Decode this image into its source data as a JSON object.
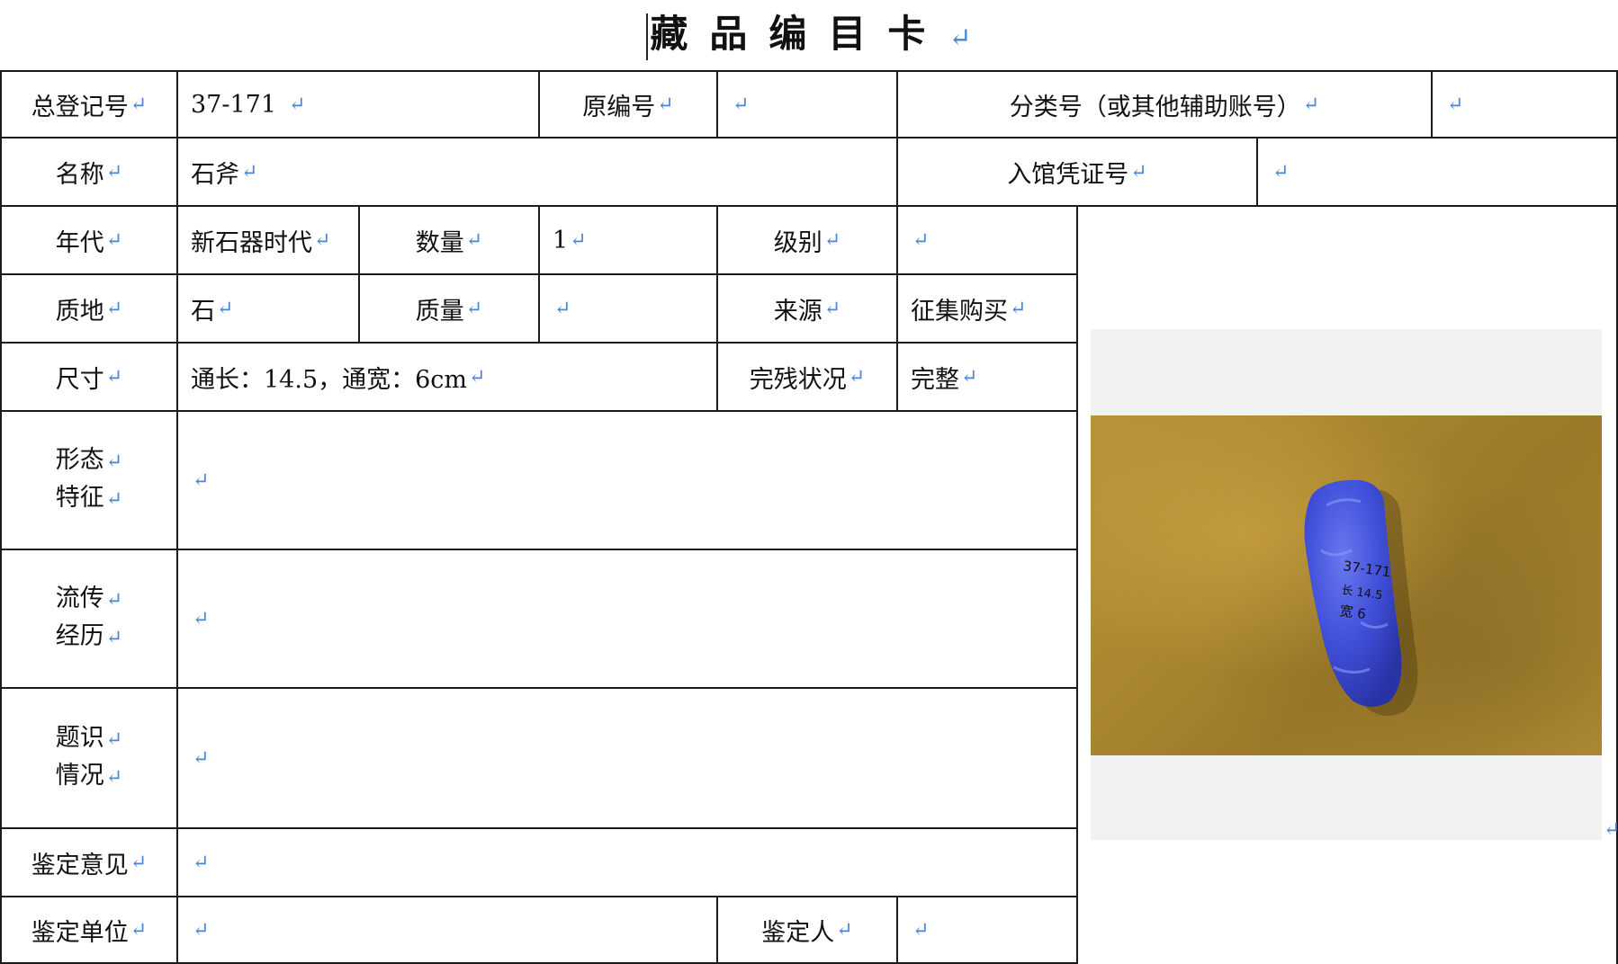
{
  "title": "藏品编目卡",
  "row1": {
    "reg_label": "总登记号",
    "reg_value": "37-171",
    "orig_label": "原编号",
    "orig_value": "",
    "class_label": "分类号（或其他辅助账号）",
    "class_value": ""
  },
  "row2": {
    "name_label": "名称",
    "name_value": "石斧",
    "voucher_label": "入馆凭证号",
    "voucher_value": ""
  },
  "row3": {
    "era_label": "年代",
    "era_value": "新石器时代",
    "qty_label": "数量",
    "qty_value": "1",
    "grade_label": "级别",
    "grade_value": ""
  },
  "row4": {
    "material_label": "质地",
    "material_value": "石",
    "mass_label": "质量",
    "mass_value": "",
    "source_label": "来源",
    "source_value": "征集购买"
  },
  "row5": {
    "size_label": "尺寸",
    "size_value": "通长：14.5，通宽：6cm",
    "condition_label": "完残状况",
    "condition_value": "完整"
  },
  "row6": {
    "label_line1": "形态",
    "label_line2": "特征",
    "value": ""
  },
  "row7": {
    "label_line1": "流传",
    "label_line2": "经历",
    "value": ""
  },
  "row8": {
    "label_line1": "题识",
    "label_line2": "情况",
    "value": ""
  },
  "row9": {
    "label": "鉴定意见",
    "value": ""
  },
  "row10": {
    "unit_label": "鉴定单位",
    "unit_value": "",
    "person_label": "鉴定人",
    "person_value": ""
  },
  "photo": {
    "alt_icon": "stone-axe-photo",
    "inscription_line1": "37-171",
    "inscription_line2": "长 14.5",
    "inscription_line3": "宽 6"
  },
  "colors": {
    "border": "#1a1a1a",
    "return_mark": "#4a86d8",
    "object": "#3f4fd8",
    "background": "#a9862f"
  },
  "return_mark_glyph": "↵"
}
